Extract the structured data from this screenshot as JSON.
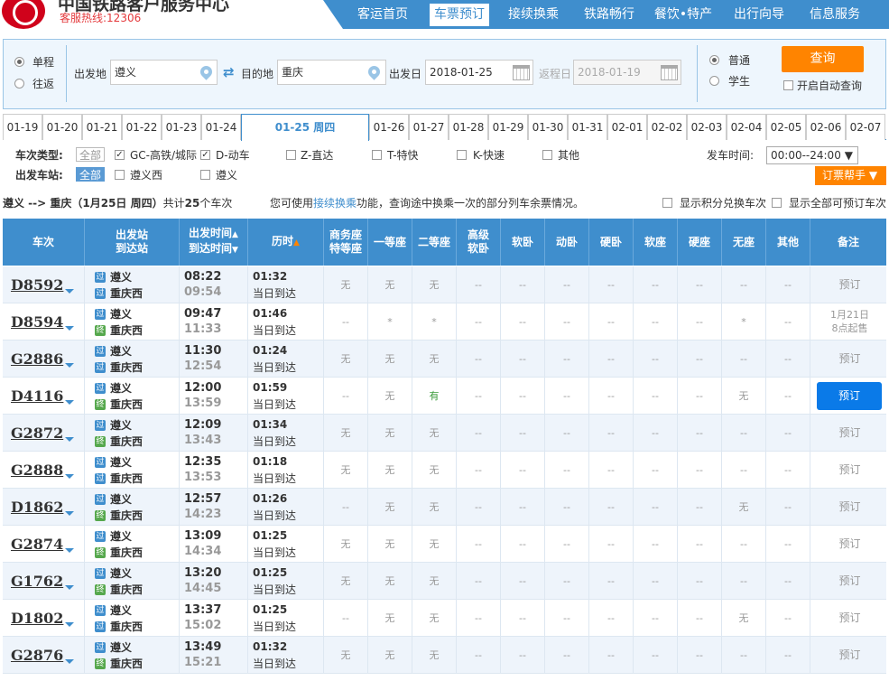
{
  "header": {
    "brand": "中国铁路客户服务中心",
    "hotline": "客服热线:12306"
  },
  "nav": [
    "客运首页",
    "车票预订",
    "接续换乘",
    "铁路畅行",
    "餐饮•特产",
    "出行向导",
    "信息服务"
  ],
  "query": {
    "oneway": "单程",
    "roundtrip": "往返",
    "from_label": "出发地",
    "from_value": "遵义",
    "to_label": "目的地",
    "to_value": "重庆",
    "date_label": "出发日",
    "date_value": "2018-01-25",
    "return_label": "返程日",
    "return_value": "2018-01-19",
    "normal": "普通",
    "student": "学生",
    "search": "查询",
    "autoquery": "开启自动查询"
  },
  "dates": [
    "01-19",
    "01-20",
    "01-21",
    "01-22",
    "01-23",
    "01-24",
    "01-25 周四",
    "01-26",
    "01-27",
    "01-28",
    "01-29",
    "01-30",
    "01-31",
    "02-01",
    "02-02",
    "02-03",
    "02-04",
    "02-05",
    "02-06",
    "02-07"
  ],
  "filters": {
    "type_label": "车次类型:",
    "all": "全部",
    "types": [
      "GC-高铁/城际",
      "D-动车",
      "Z-直达",
      "T-特快",
      "K-快速",
      "其他"
    ],
    "station_label": "出发车站:",
    "stations": [
      "遵义西",
      "遵义"
    ],
    "time_label": "发车时间:",
    "time_value": "00:00--24:00",
    "helper": "订票帮手"
  },
  "summary": {
    "route": "遵义 --> 重庆（1月25日  周四）",
    "count_prefix": "共计",
    "count": "25",
    "count_suffix": "个车次",
    "tip_pre": "您可使用",
    "tip_link": "接续换乘",
    "tip_post": "功能，查询途中换乘一次的部分列车余票情况。",
    "opt1": "显示积分兑换车次",
    "opt2": "显示全部可预订车次"
  },
  "columns": {
    "train": "车次",
    "st1": "出发站",
    "st2": "到达站",
    "t1": "出发时间",
    "t2": "到达时间",
    "dur": "历时",
    "biz1": "商务座",
    "biz2": "特等座",
    "first": "一等座",
    "second": "二等座",
    "hs1": "高级",
    "hs2": "软卧",
    "sleeper_soft": "软卧",
    "dong": "动卧",
    "sleeper_hard": "硬卧",
    "seat_soft": "软座",
    "seat_hard": "硬座",
    "noseat": "无座",
    "other": "其他",
    "note": "备注"
  },
  "station_icons": {
    "start": "过",
    "end": "终"
  },
  "trains": [
    {
      "no": "D8592",
      "from": "遵义",
      "to": "重庆西",
      "fi": "过",
      "ti": "过",
      "dep": "08:22",
      "arr": "09:54",
      "dur": "01:32",
      "day": "当日到达",
      "seats": [
        "无",
        "无",
        "无",
        "--",
        "--",
        "--",
        "--",
        "--",
        "--",
        "--",
        "--"
      ],
      "note": "预订",
      "status": "grey"
    },
    {
      "no": "D8594",
      "from": "遵义",
      "to": "重庆西",
      "fi": "过",
      "ti": "终",
      "dep": "09:47",
      "arr": "11:33",
      "dur": "01:46",
      "day": "当日到达",
      "seats": [
        "--",
        "*",
        "*",
        "--",
        "--",
        "--",
        "--",
        "--",
        "--",
        "*",
        "--"
      ],
      "note": "1月21日 8点起售",
      "note_line2": "8点起售",
      "note_line1": "1月21日",
      "status": "presale"
    },
    {
      "no": "G2886",
      "from": "遵义",
      "to": "重庆西",
      "fi": "过",
      "ti": "过",
      "dep": "11:30",
      "arr": "12:54",
      "dur": "01:24",
      "day": "当日到达",
      "seats": [
        "无",
        "无",
        "无",
        "--",
        "--",
        "--",
        "--",
        "--",
        "--",
        "--",
        "--"
      ],
      "note": "预订",
      "status": "grey"
    },
    {
      "no": "D4116",
      "from": "遵义",
      "to": "重庆西",
      "fi": "过",
      "ti": "终",
      "dep": "12:00",
      "arr": "13:59",
      "dur": "01:59",
      "day": "当日到达",
      "seats": [
        "--",
        "无",
        "有",
        "--",
        "--",
        "--",
        "--",
        "--",
        "--",
        "无",
        "--"
      ],
      "note": "预订",
      "status": "blue"
    },
    {
      "no": "G2872",
      "from": "遵义",
      "to": "重庆西",
      "fi": "过",
      "ti": "终",
      "dep": "12:09",
      "arr": "13:43",
      "dur": "01:34",
      "day": "当日到达",
      "seats": [
        "无",
        "无",
        "无",
        "--",
        "--",
        "--",
        "--",
        "--",
        "--",
        "--",
        "--"
      ],
      "note": "预订",
      "status": "grey"
    },
    {
      "no": "G2888",
      "from": "遵义",
      "to": "重庆西",
      "fi": "过",
      "ti": "过",
      "dep": "12:35",
      "arr": "13:53",
      "dur": "01:18",
      "day": "当日到达",
      "seats": [
        "无",
        "无",
        "无",
        "--",
        "--",
        "--",
        "--",
        "--",
        "--",
        "--",
        "--"
      ],
      "note": "预订",
      "status": "grey"
    },
    {
      "no": "D1862",
      "from": "遵义",
      "to": "重庆西",
      "fi": "过",
      "ti": "终",
      "dep": "12:57",
      "arr": "14:23",
      "dur": "01:26",
      "day": "当日到达",
      "seats": [
        "--",
        "无",
        "无",
        "--",
        "--",
        "--",
        "--",
        "--",
        "--",
        "无",
        "--"
      ],
      "note": "预订",
      "status": "grey"
    },
    {
      "no": "G2874",
      "from": "遵义",
      "to": "重庆西",
      "fi": "过",
      "ti": "终",
      "dep": "13:09",
      "arr": "14:34",
      "dur": "01:25",
      "day": "当日到达",
      "seats": [
        "无",
        "无",
        "无",
        "--",
        "--",
        "--",
        "--",
        "--",
        "--",
        "--",
        "--"
      ],
      "note": "预订",
      "status": "grey"
    },
    {
      "no": "G1762",
      "from": "遵义",
      "to": "重庆西",
      "fi": "过",
      "ti": "终",
      "dep": "13:20",
      "arr": "14:45",
      "dur": "01:25",
      "day": "当日到达",
      "seats": [
        "无",
        "无",
        "无",
        "--",
        "--",
        "--",
        "--",
        "--",
        "--",
        "--",
        "--"
      ],
      "note": "预订",
      "status": "grey"
    },
    {
      "no": "D1802",
      "from": "遵义",
      "to": "重庆西",
      "fi": "过",
      "ti": "过",
      "dep": "13:37",
      "arr": "15:02",
      "dur": "01:25",
      "day": "当日到达",
      "seats": [
        "--",
        "无",
        "无",
        "--",
        "--",
        "--",
        "--",
        "--",
        "--",
        "无",
        "--"
      ],
      "note": "预订",
      "status": "grey"
    },
    {
      "no": "G2876",
      "from": "遵义",
      "to": "重庆西",
      "fi": "过",
      "ti": "终",
      "dep": "13:49",
      "arr": "15:21",
      "dur": "01:32",
      "day": "当日到达",
      "seats": [
        "无",
        "无",
        "无",
        "--",
        "--",
        "--",
        "--",
        "--",
        "--",
        "--",
        "--"
      ],
      "note": "预订",
      "status": "grey"
    }
  ]
}
